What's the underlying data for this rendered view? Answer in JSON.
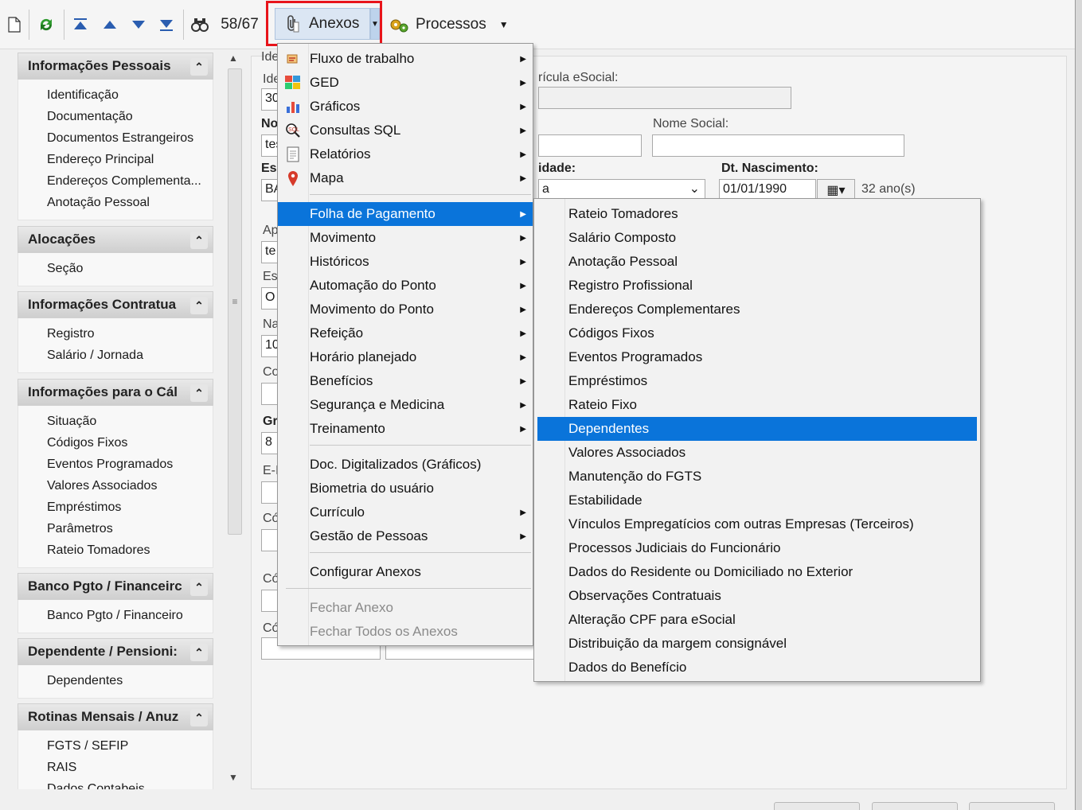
{
  "toolbar": {
    "counter": "58/67",
    "anexos_label": "Anexos",
    "processos_label": "Processos"
  },
  "sidebar": {
    "groups": [
      {
        "title": "Informações Pessoais",
        "items": [
          "Identificação",
          "Documentação",
          "Documentos Estrangeiros",
          "Endereço Principal",
          "Endereços Complementa...",
          "Anotação Pessoal"
        ]
      },
      {
        "title": "Alocações",
        "items": [
          "Seção"
        ]
      },
      {
        "title": "Informações Contratua",
        "items": [
          "Registro",
          "Salário / Jornada"
        ]
      },
      {
        "title": "Informações para o Cál",
        "items": [
          "Situação",
          "Códigos Fixos",
          "Eventos Programados",
          "Valores Associados",
          "Empréstimos",
          "Parâmetros",
          "Rateio Tomadores"
        ]
      },
      {
        "title": "Banco Pgto / Financeirc",
        "items": [
          "Banco Pgto / Financeiro"
        ]
      },
      {
        "title": "Dependente / Pensioni:",
        "items": [
          "Dependentes"
        ]
      },
      {
        "title": "Rotinas Mensais / Anuz",
        "items": [
          "FGTS / SEFIP",
          "RAIS",
          "Dados Contabeis"
        ]
      }
    ]
  },
  "form": {
    "labels": {
      "ide1": "Ide",
      "ide2": "Ide",
      "matricula": "rícula eSocial:",
      "no": "No",
      "nome_social": "Nome Social:",
      "es": "Es",
      "idade": "idade:",
      "dt_nasc": "Dt. Nascimento:",
      "ap": "Ap",
      "es2": "Es",
      "na": "Na",
      "co": "Co",
      "gr": "Gr",
      "ei": "E-I",
      "co2": "Có",
      "co3": "Có",
      "co4": "Có"
    },
    "values": {
      "ide": "30",
      "nome": "tes",
      "es": "BA",
      "ap": "te",
      "es2": "O",
      "na": "10",
      "gr": "8",
      "dt_nasc": "01/01/1990",
      "age": "32 ano(s)",
      "idade_value": "a"
    }
  },
  "anexos_menu": {
    "items": [
      {
        "label": "Fluxo de trabalho",
        "icon": "workflow-icon",
        "glyph": "🗂",
        "submenu": true
      },
      {
        "label": "GED",
        "icon": "ged-icon",
        "glyph": "🧩",
        "submenu": true
      },
      {
        "label": "Gráficos",
        "icon": "chart-icon",
        "glyph": "📊",
        "submenu": true
      },
      {
        "label": "Consultas SQL",
        "icon": "sql-query-icon",
        "glyph": "🔍",
        "submenu": true
      },
      {
        "label": "Relatórios",
        "icon": "report-icon",
        "glyph": "📄",
        "submenu": true
      },
      {
        "label": "Mapa",
        "icon": "map-pin-icon",
        "glyph": "📍",
        "submenu": true
      },
      {
        "label": "Folha de Pagamento",
        "submenu": true,
        "highlighted": true
      },
      {
        "label": "Movimento",
        "submenu": true
      },
      {
        "label": "Históricos",
        "submenu": true
      },
      {
        "label": "Automação do Ponto",
        "submenu": true
      },
      {
        "label": "Movimento do Ponto",
        "submenu": true
      },
      {
        "label": "Refeição",
        "submenu": true
      },
      {
        "label": "Horário planejado",
        "submenu": true
      },
      {
        "label": "Benefícios",
        "submenu": true
      },
      {
        "label": "Segurança e Medicina",
        "submenu": true
      },
      {
        "label": "Treinamento",
        "submenu": true
      },
      {
        "label": "Doc. Digitalizados (Gráficos)",
        "submenu": false
      },
      {
        "label": "Biometria do usuário",
        "submenu": false
      },
      {
        "label": "Currículo",
        "submenu": true
      },
      {
        "label": "Gestão de Pessoas",
        "submenu": true
      },
      {
        "label": "Configurar Anexos",
        "submenu": false
      },
      {
        "label": "Fechar Anexo",
        "submenu": false,
        "disabled": true
      },
      {
        "label": "Fechar Todos os Anexos",
        "submenu": false,
        "disabled": true
      }
    ]
  },
  "folha_submenu": {
    "items": [
      "Rateio Tomadores",
      "Salário Composto",
      "Anotação Pessoal",
      "Registro Profissional",
      "Endereços Complementares",
      "Códigos Fixos",
      "Eventos Programados",
      "Empréstimos",
      "Rateio Fixo",
      "Dependentes",
      "Valores Associados",
      "Manutenção do FGTS",
      "Estabilidade",
      "Vínculos Empregatícios com outras Empresas (Terceiros)",
      "Processos Judiciais do Funcionário",
      "Dados do Residente ou Domiciliado no Exterior",
      "Observações Contratuais",
      "Alteração CPF para eSocial",
      "Distribuição da margem consignável",
      "Dados do Benefício"
    ],
    "highlighted": "Dependentes"
  },
  "colors": {
    "highlight": "#0a74da",
    "focus_border": "#e8141a"
  }
}
